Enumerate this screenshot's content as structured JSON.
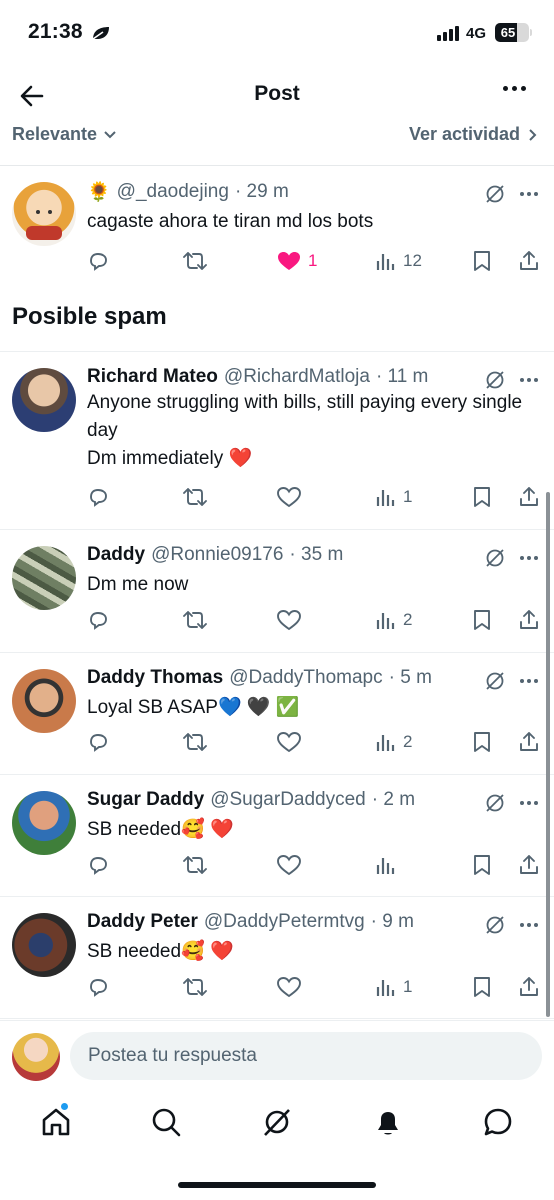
{
  "status": {
    "time": "21:38",
    "network": "4G",
    "battery": "65",
    "battery_level": 0.65
  },
  "header": {
    "title": "Post"
  },
  "filter": {
    "left_label": "Relevante",
    "right_label": "Ver actividad"
  },
  "section_title": "Posible spam",
  "tweets": [
    {
      "emoji": "🌻",
      "name": "",
      "handle": "@_daodejing",
      "time": "· 29 m",
      "text": "cagaste ahora te tiran md los bots",
      "likes": "1",
      "views": "12",
      "liked": true
    },
    {
      "name": "Richard Mateo",
      "handle": "@RichardMatloja",
      "time": "· 11 m",
      "text": "Anyone struggling with bills,  still paying every single day\nDm immediately ❤️",
      "likes": "",
      "views": "1"
    },
    {
      "name": "Daddy",
      "handle": "@Ronnie09176",
      "time": "· 35 m",
      "text": "Dm me now",
      "likes": "",
      "views": "2"
    },
    {
      "name": "Daddy Thomas",
      "handle": "@DaddyThomapc",
      "time": "· 5 m",
      "text": "Loyal SB ASAP💙 🖤 ✅",
      "likes": "",
      "views": "2"
    },
    {
      "name": "Sugar Daddy",
      "handle": "@SugarDaddyced",
      "time": "· 2 m",
      "text": "SB needed🥰 ❤️",
      "likes": "",
      "views": ""
    },
    {
      "name": "Daddy Peter",
      "handle": "@DaddyPetermtvg",
      "time": "· 9 m",
      "text": "SB needed🥰 ❤️",
      "likes": "",
      "views": "1"
    }
  ],
  "reply": {
    "placeholder": "Postea tu respuesta"
  },
  "tabs": [
    "home-icon",
    "search-icon",
    "grok-icon",
    "notifications-icon",
    "messages-icon"
  ],
  "colors": {
    "like": "#f91880",
    "muted": "#536471",
    "accent": "#1d9bf0"
  }
}
